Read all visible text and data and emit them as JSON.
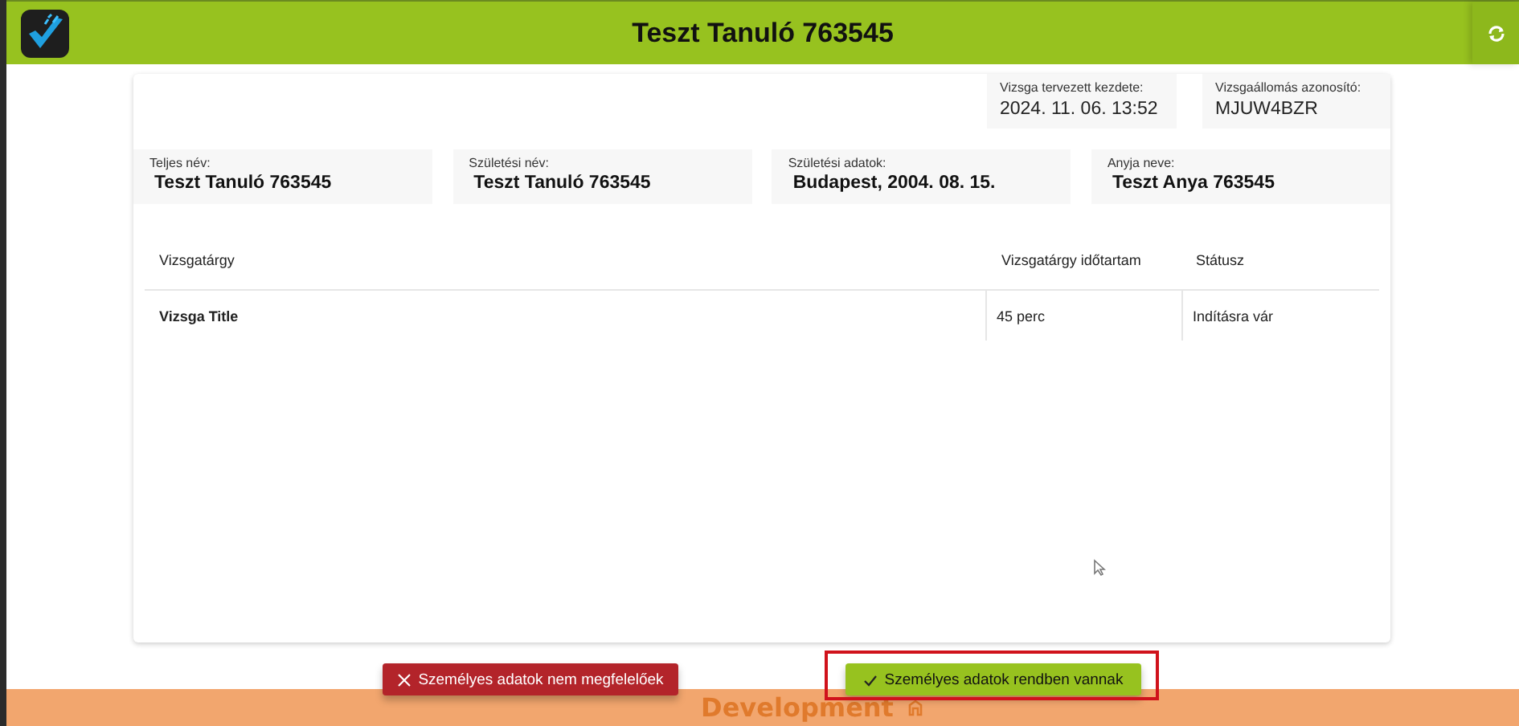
{
  "header": {
    "title": "Teszt Tanuló 763545"
  },
  "exam_info": [
    {
      "label": "Vizsga tervezett kezdete:",
      "value": "2024. 11. 06. 13:52"
    },
    {
      "label": "Vizsgaállomás azonosító:",
      "value": "MJUW4BZR"
    }
  ],
  "personal_info": [
    {
      "label": "Teljes név:",
      "value": "Teszt Tanuló 763545"
    },
    {
      "label": "Születési név:",
      "value": "Teszt Tanuló 763545"
    },
    {
      "label": "Születési adatok:",
      "value": "Budapest,  2004. 08. 15."
    },
    {
      "label": "Anyja neve:",
      "value": "Teszt Anya 763545"
    }
  ],
  "table": {
    "columns": [
      "Vizsgatárgy",
      "Vizsgatárgy időtartam",
      "Státusz"
    ],
    "rows": [
      [
        "Vizsga Title",
        "45 perc",
        "Indításra vár"
      ]
    ]
  },
  "buttons": [
    {
      "kind": "reject",
      "label": "Személyes adatok nem megfelelőek",
      "highlighted": false
    },
    {
      "kind": "accept",
      "label": "Személyes adatok rendben vannak",
      "highlighted": true
    }
  ],
  "environment_bar": {
    "label": "Development"
  }
}
